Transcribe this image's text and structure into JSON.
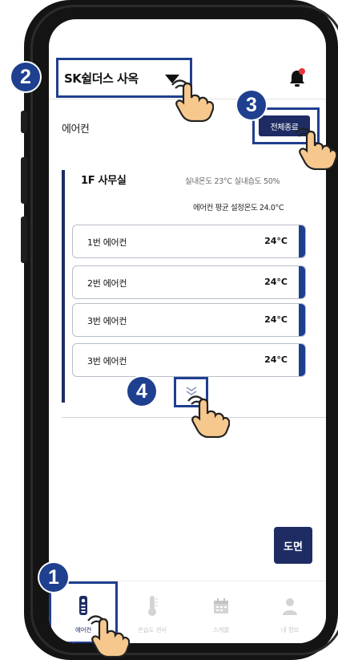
{
  "header": {
    "site_name": "SK쉴더스 사옥"
  },
  "section": {
    "title": "에어컨",
    "all_off_label": "전체종료"
  },
  "room": {
    "name": "1F 사무실",
    "indoor_status": "실내온도 23°C  실내습도 50%",
    "avg_setpoint": "에어컨 평균 설정온도 24.0°C",
    "units": [
      {
        "name": "1번 에어컨",
        "temp": "24°C"
      },
      {
        "name": "2번 에어컨",
        "temp": "24°C"
      },
      {
        "name": "3번 에어컨",
        "temp": "24°C"
      },
      {
        "name": "3번 에어컨",
        "temp": "24°C"
      }
    ]
  },
  "floorplan_label": "도면",
  "tabs": [
    {
      "label": "에어컨",
      "icon": "remote-icon",
      "active": true
    },
    {
      "label": "온습도 센서",
      "icon": "thermometer-icon",
      "active": false
    },
    {
      "label": "스케쥴",
      "icon": "calendar-icon",
      "active": false
    },
    {
      "label": "내 정보",
      "icon": "person-icon",
      "active": false
    }
  ],
  "callouts": [
    "1",
    "2",
    "3",
    "4"
  ],
  "colors": {
    "primary": "#1e2c63",
    "callout": "#1f3f8f",
    "notification_dot": "#e8333c"
  }
}
